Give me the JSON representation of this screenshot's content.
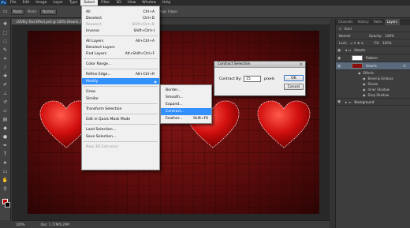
{
  "app": {
    "logo": "Ps"
  },
  "menubar": [
    "File",
    "Edit",
    "Image",
    "Layer",
    "Type",
    "Select",
    "Filter",
    "3D",
    "View",
    "Window",
    "Help"
  ],
  "menubar_active": "Select",
  "options": {
    "feather_select": "Pixels",
    "mode_label": "Mode:",
    "mode_value": "Normal",
    "shape_label": "Shape:",
    "align_label": "Align Edges"
  },
  "document": {
    "tab_title": "LOVEly Text Effect.psd @ 100% (Hearts, RGB/8*) ×",
    "zoom": "100%",
    "doc_info": "Doc: 1.72M/6.29M"
  },
  "select_menu": {
    "all": {
      "label": "All",
      "shortcut": "Ctrl+A"
    },
    "deselect": {
      "label": "Deselect",
      "shortcut": "Ctrl+D"
    },
    "reselect": {
      "label": "Reselect",
      "shortcut": "Shift+Ctrl+D"
    },
    "inverse": {
      "label": "Inverse",
      "shortcut": "Shift+Ctrl+I"
    },
    "all_layers": {
      "label": "All Layers",
      "shortcut": "Alt+Ctrl+A"
    },
    "deselect_layers": {
      "label": "Deselect Layers",
      "shortcut": ""
    },
    "find_layers": {
      "label": "Find Layers",
      "shortcut": "Alt+Shift+Ctrl+F"
    },
    "color_range": {
      "label": "Color Range...",
      "shortcut": ""
    },
    "refine_edge": {
      "label": "Refine Edge...",
      "shortcut": "Alt+Ctrl+R"
    },
    "modify": {
      "label": "Modify",
      "shortcut": ""
    },
    "grow": {
      "label": "Grow",
      "shortcut": ""
    },
    "similar": {
      "label": "Similar",
      "shortcut": ""
    },
    "transform_selection": {
      "label": "Transform Selection",
      "shortcut": ""
    },
    "quick_mask": {
      "label": "Edit in Quick Mask Mode",
      "shortcut": ""
    },
    "load_selection": {
      "label": "Load Selection...",
      "shortcut": ""
    },
    "save_selection": {
      "label": "Save Selection...",
      "shortcut": ""
    },
    "new_3d": {
      "label": "New 3D Extrusion",
      "shortcut": ""
    }
  },
  "modify_submenu": {
    "border": {
      "label": "Border...",
      "shortcut": ""
    },
    "smooth": {
      "label": "Smooth...",
      "shortcut": ""
    },
    "expand": {
      "label": "Expand...",
      "shortcut": ""
    },
    "contract": {
      "label": "Contract...",
      "shortcut": ""
    },
    "feather": {
      "label": "Feather...",
      "shortcut": "Shift+F6"
    }
  },
  "dialog": {
    "title": "Contract Selection",
    "field_label": "Contract By:",
    "value": "15",
    "unit": "pixels",
    "ok": "OK",
    "cancel": "Cancel"
  },
  "panels": {
    "tabs": [
      "Channels",
      "History",
      "Paths",
      "Layers"
    ],
    "active_tab": "Layers",
    "kind_label": "Kind",
    "blend": "Normal",
    "opacity_label": "Opacity:",
    "opacity": "100%",
    "lock_label": "Lock:",
    "fill_label": "Fill:",
    "fill": "100%",
    "layers": [
      {
        "name": "Hearts",
        "type": "group"
      },
      {
        "name": "Pattern",
        "type": "layer"
      },
      {
        "name": "Hearts",
        "type": "layer"
      }
    ],
    "effects_label": "Effects",
    "effects": [
      "Bevel & Emboss",
      "Stroke",
      "Inner Shadow",
      "Drop Shadow"
    ],
    "background_group": "Background"
  },
  "colors": {
    "foreground": "#c00000",
    "background": "#000000",
    "highlight": "#3390ff"
  }
}
